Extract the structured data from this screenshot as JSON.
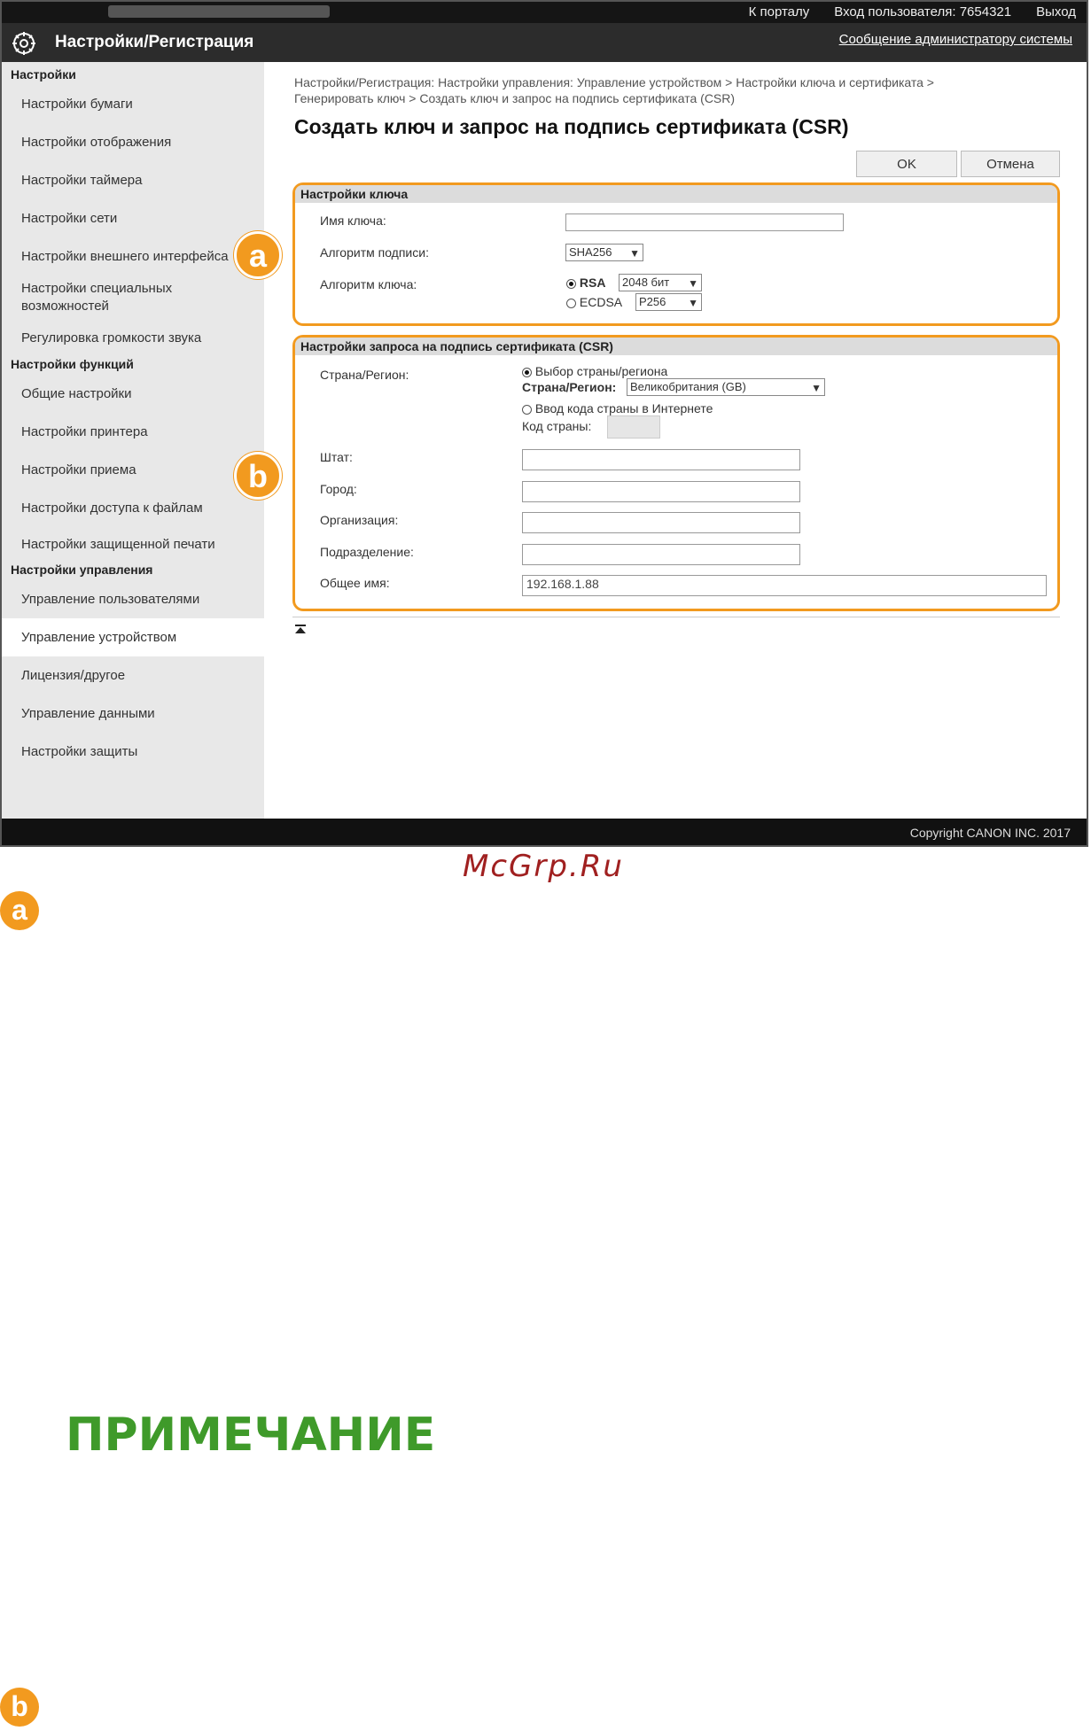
{
  "topbar": {
    "portal": "К порталу",
    "login_label": "Вход пользователя:",
    "user_id": "7654321",
    "logout": "Выход"
  },
  "titlebar": {
    "title": "Настройки/Регистрация",
    "admin_message": "Сообщение администратору системы"
  },
  "sidebar": {
    "settings_header": "Настройки",
    "settings_items": [
      "Настройки бумаги",
      "Настройки отображения",
      "Настройки таймера",
      "Настройки сети",
      "Настройки внешнего интерфейса",
      "Настройки специальных возможностей",
      "Регулировка громкости звука"
    ],
    "functions_header": "Настройки функций",
    "functions_items": [
      "Общие настройки",
      "Настройки принтера",
      "Настройки приема",
      "Настройки доступа к файлам",
      "Настройки защищенной печати"
    ],
    "management_header": "Настройки управления",
    "management_items": [
      "Управление пользователями",
      "Управление устройством",
      "Лицензия/другое",
      "Управление данными",
      "Настройки защиты"
    ]
  },
  "content": {
    "breadcrumb_line1": "Настройки/Регистрация: Настройки управления: Управление устройством > Настройки ключа и сертификата >",
    "breadcrumb_line2": "Генерировать ключ > Создать ключ и запрос на подпись сертификата (CSR)",
    "title": "Создать ключ и запрос на подпись сертификата (CSR)",
    "ok": "OK",
    "cancel": "Отмена",
    "key_settings": {
      "header": "Настройки ключа",
      "key_name_label": "Имя ключа:",
      "key_name_value": "",
      "sig_alg_label": "Алгоритм подписи:",
      "sig_alg_value": "SHA256",
      "key_alg_label": "Алгоритм ключа:",
      "rsa_label": "RSA",
      "rsa_value": "2048 бит",
      "ecdsa_label": "ECDSA",
      "ecdsa_value": "P256"
    },
    "csr_settings": {
      "header": "Настройки запроса на подпись сертификата (CSR)",
      "country_label": "Страна/Регион:",
      "select_country": "Выбор страны/региона",
      "country_region_label": "Страна/Регион:",
      "country_value": "Великобритания (GB)",
      "enter_code": "Ввод кода страны в Интернете",
      "country_code_label": "Код страны:",
      "state_label": "Штат:",
      "city_label": "Город:",
      "org_label": "Организация:",
      "unit_label": "Подразделение:",
      "common_name_label": "Общее имя:",
      "common_name_value": "192.168.1.88"
    }
  },
  "badges": {
    "a": "a",
    "b": "b"
  },
  "footer": "Copyright CANON INC. 2017",
  "watermark": "McGrp.Ru",
  "note_title": "ПРИМЕЧАНИЕ"
}
